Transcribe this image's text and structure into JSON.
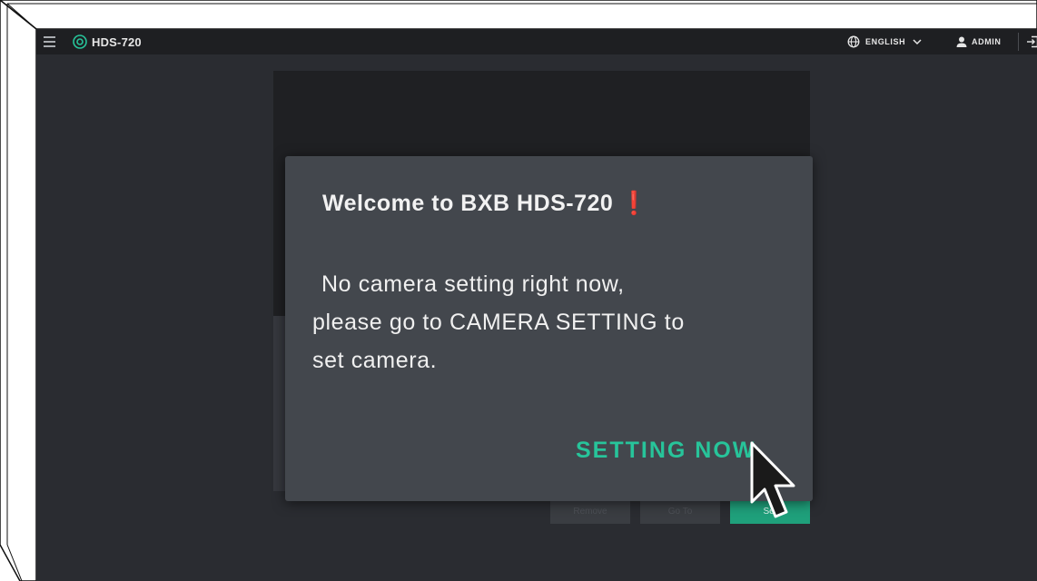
{
  "header": {
    "app_title": "HDS-720",
    "language_label": "ENGLISH",
    "user_label": "ADMIN"
  },
  "dialog": {
    "title": "Welcome to BXB HDS-720 ❗",
    "message_line1": "No camera setting right now,",
    "message_line2": "please go to CAMERA SETTING to",
    "message_line3": "set camera.",
    "action_label": "SETTING NOW"
  },
  "background_buttons": {
    "remove": "Remove",
    "goto": "Go To",
    "set": "Set"
  },
  "colors": {
    "accent": "#27c49a",
    "topbar": "#1e1f22",
    "background": "#2a2c31",
    "dialog": "#43474d"
  },
  "icons": {
    "menu": "hamburger-menu-icon",
    "logo": "camera-lens-icon",
    "language": "globe-icon",
    "dropdown": "chevron-down-icon",
    "user": "user-icon",
    "logout": "logout-icon",
    "pointer": "mouse-pointer-icon"
  }
}
